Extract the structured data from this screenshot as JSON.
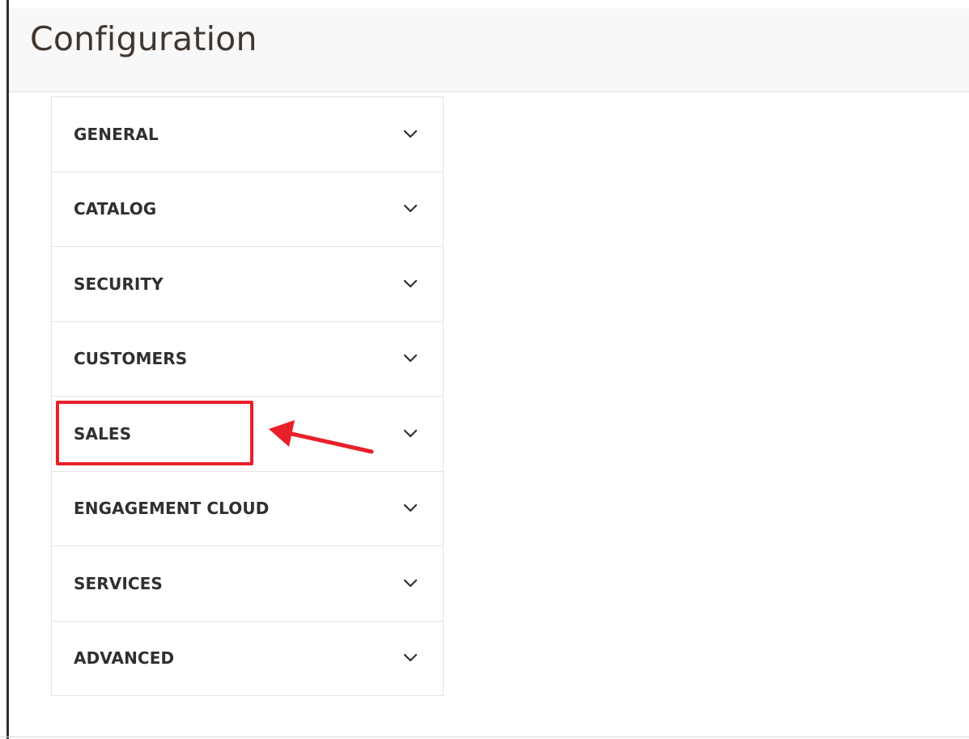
{
  "page": {
    "title": "Configuration"
  },
  "nav": {
    "items": [
      {
        "label": "GENERAL",
        "icon": "chevron-down-icon"
      },
      {
        "label": "CATALOG",
        "icon": "chevron-down-icon"
      },
      {
        "label": "SECURITY",
        "icon": "chevron-down-icon"
      },
      {
        "label": "CUSTOMERS",
        "icon": "chevron-down-icon"
      },
      {
        "label": "SALES",
        "icon": "chevron-down-icon"
      },
      {
        "label": "ENGAGEMENT CLOUD",
        "icon": "chevron-down-icon"
      },
      {
        "label": "SERVICES",
        "icon": "chevron-down-icon"
      },
      {
        "label": "ADVANCED",
        "icon": "chevron-down-icon"
      }
    ]
  },
  "annotation": {
    "highlighted_item": "SALES",
    "color": "#e8202a"
  },
  "colors": {
    "header_background": "#f8f8f8",
    "title_text": "#41362f",
    "nav_text": "#303030",
    "border": "#e3e3e3",
    "annotation": "#e8202a"
  }
}
